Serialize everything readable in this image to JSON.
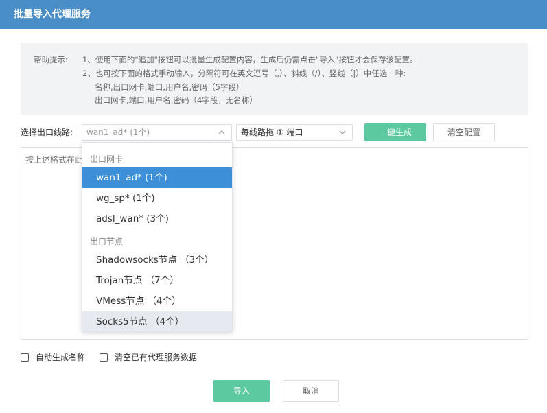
{
  "title": "批量导入代理服务",
  "help": {
    "label": "帮助提示:",
    "line1": "1、使用下面的\"追加\"按钮可以批量生成配置内容，生成后仍需点击\"导入\"按钮才会保存该配置。",
    "line2": "2、也可按下面的格式手动输入，分隔符可在英文逗号（,）、斜线（/）、竖线（|）中任选一种:",
    "line3": "名称,出口网卡,端口,用户名,密码（5字段）",
    "line4": "出口网卡,端口,用户名,密码（4字段，无名称）"
  },
  "form": {
    "route_label": "选择出口线路:",
    "route_value": "wan1_ad* (1个)",
    "strategy_value": "每线路拖 ① 端口",
    "generate_label": "一键生成",
    "clear_label": "清空配置",
    "textarea_placeholder": "按上述格式在此"
  },
  "dropdown": {
    "group1_label": "出口网卡",
    "group1_items": [
      "wan1_ad* (1个)",
      "wg_sp* (1个)",
      "adsl_wan* (3个)"
    ],
    "group2_label": "出口节点",
    "group2_items": [
      "Shadowsocks节点 （3个）",
      "Trojan节点 （7个）",
      "VMess节点 （4个）",
      "Socks5节点 （4个）"
    ]
  },
  "options": {
    "auto_name_label": "自动生成名称",
    "clear_existing_label": "清空已有代理服务数据"
  },
  "footer": {
    "import_label": "导入",
    "cancel_label": "取消"
  },
  "colors": {
    "titlebar": "#4a8ec8",
    "accent_green": "#5cc9a0",
    "selected_item": "#3d8fd8"
  }
}
